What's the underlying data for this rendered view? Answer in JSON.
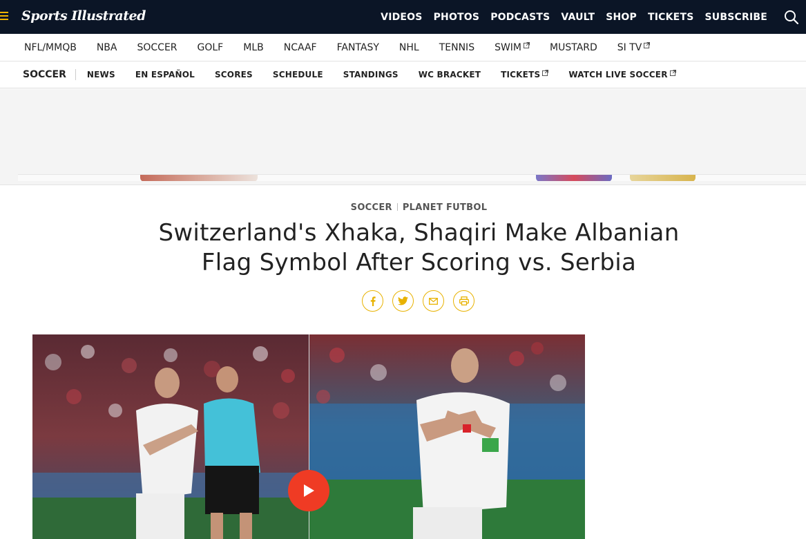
{
  "brand": {
    "logo_text": "Sports Illustrated"
  },
  "topnav": {
    "items": [
      "VIDEOS",
      "PHOTOS",
      "PODCASTS",
      "VAULT",
      "SHOP",
      "TICKETS",
      "SUBSCRIBE"
    ]
  },
  "sportsnav": {
    "items": [
      {
        "label": "NFL/MMQB",
        "external": false
      },
      {
        "label": "NBA",
        "external": false
      },
      {
        "label": "SOCCER",
        "external": false
      },
      {
        "label": "GOLF",
        "external": false
      },
      {
        "label": "MLB",
        "external": false
      },
      {
        "label": "NCAAF",
        "external": false
      },
      {
        "label": "FANTASY",
        "external": false
      },
      {
        "label": "NHL",
        "external": false
      },
      {
        "label": "TENNIS",
        "external": false
      },
      {
        "label": "SWIM",
        "external": true
      },
      {
        "label": "MUSTARD",
        "external": false
      },
      {
        "label": "SI TV",
        "external": true
      }
    ]
  },
  "secnav": {
    "title": "SOCCER",
    "items": [
      {
        "label": "NEWS",
        "external": false
      },
      {
        "label": "EN ESPAÑOL",
        "external": false
      },
      {
        "label": "SCORES",
        "external": false
      },
      {
        "label": "SCHEDULE",
        "external": false
      },
      {
        "label": "STANDINGS",
        "external": false
      },
      {
        "label": "WC BRACKET",
        "external": false
      },
      {
        "label": "TICKETS",
        "external": true
      },
      {
        "label": "WATCH LIVE SOCCER",
        "external": true
      }
    ]
  },
  "article": {
    "kicker_primary": "SOCCER",
    "kicker_secondary": "PLANET FUTBOL",
    "headline": "Switzerland's Xhaka, Shaqiri Make Albanian Flag Symbol After Scoring vs. Serbia"
  },
  "share": {
    "buttons": [
      {
        "name": "facebook-share-button",
        "icon": "facebook-icon"
      },
      {
        "name": "twitter-share-button",
        "icon": "twitter-icon"
      },
      {
        "name": "email-share-button",
        "icon": "email-icon"
      },
      {
        "name": "print-button",
        "icon": "print-icon"
      }
    ]
  },
  "colors": {
    "header_bg": "#0b1526",
    "accent": "#e8b200",
    "play_button": "#ef3b24"
  }
}
